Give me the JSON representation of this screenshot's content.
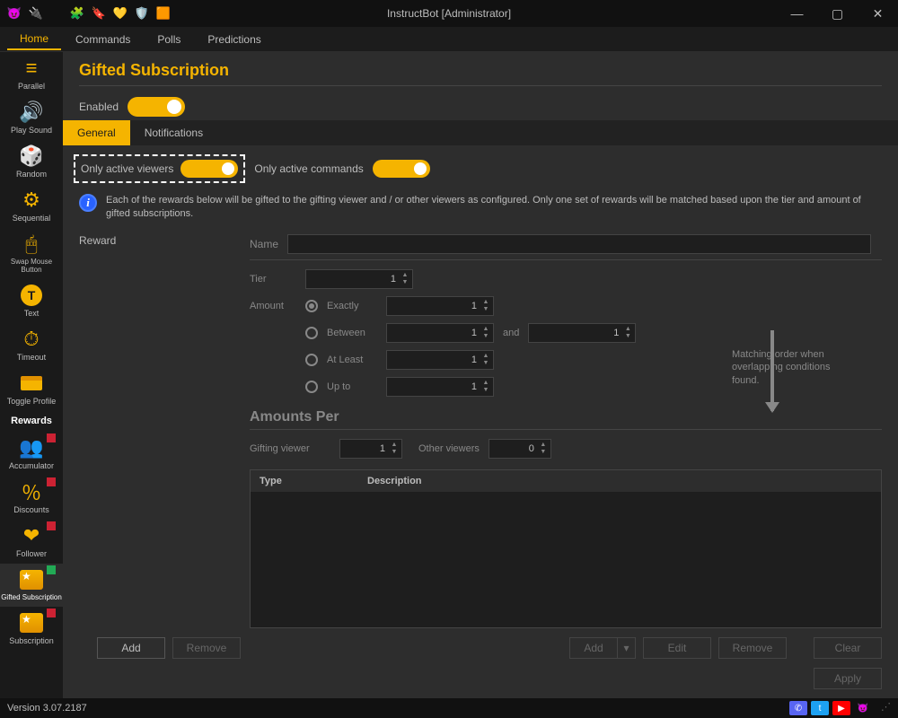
{
  "window": {
    "title": "InstructBot [Administrator]"
  },
  "menubar": {
    "items": [
      "Home",
      "Commands",
      "Polls",
      "Predictions"
    ],
    "active": 0
  },
  "sidebar": {
    "items": [
      {
        "label": "Parallel",
        "icon": "parallel"
      },
      {
        "label": "Play Sound",
        "icon": "speaker"
      },
      {
        "label": "Random",
        "icon": "dice"
      },
      {
        "label": "Sequential",
        "icon": "seq"
      },
      {
        "label": "Swap Mouse Button",
        "icon": "mouse"
      },
      {
        "label": "Text",
        "icon": "text"
      },
      {
        "label": "Timeout",
        "icon": "clock"
      },
      {
        "label": "Toggle Profile",
        "icon": "profile"
      },
      {
        "label": "Rewards",
        "section": true
      },
      {
        "label": "Accumulator",
        "icon": "accum",
        "badge": "red"
      },
      {
        "label": "Discounts",
        "icon": "disc",
        "badge": "red"
      },
      {
        "label": "Follower",
        "icon": "heart",
        "badge": "red"
      },
      {
        "label": "Gifted Subscription",
        "icon": "box",
        "badge": "green",
        "active": true
      },
      {
        "label": "Subscription",
        "icon": "gift",
        "badge": "red"
      }
    ]
  },
  "page": {
    "title": "Gifted Subscription",
    "enabled_label": "Enabled",
    "subtabs": [
      "General",
      "Notifications"
    ],
    "subtab_active": 0,
    "only_active_viewers": "Only active viewers",
    "only_active_commands": "Only active commands",
    "info": "Each of the rewards below will be gifted to the gifting viewer and / or other viewers as configured. Only one set of rewards will be matched based upon the tier and amount of gifted subscriptions.",
    "reward_col": "Reward",
    "name_label": "Name",
    "tier_label": "Tier",
    "tier_value": "1",
    "amount_label": "Amount",
    "amount_opts": {
      "exactly": "Exactly",
      "between": "Between",
      "atleast": "At Least",
      "upto": "Up to"
    },
    "amount_exactly_val": "1",
    "amount_between_a": "1",
    "amount_between_and": "and",
    "amount_between_b": "1",
    "amount_atleast_val": "1",
    "amount_upto_val": "1",
    "arrow_text": "Matching order when overlapping conditions found.",
    "amounts_per_title": "Amounts Per",
    "gifting_viewer_label": "Gifting viewer",
    "gifting_viewer_val": "1",
    "other_viewers_label": "Other viewers",
    "other_viewers_val": "0",
    "grid": {
      "type": "Type",
      "description": "Description"
    },
    "buttons": {
      "add": "Add",
      "remove": "Remove",
      "add2": "Add",
      "edit": "Edit",
      "remove2": "Remove",
      "clear": "Clear",
      "apply": "Apply"
    }
  },
  "statusbar": {
    "version": "Version 3.07.2187"
  }
}
